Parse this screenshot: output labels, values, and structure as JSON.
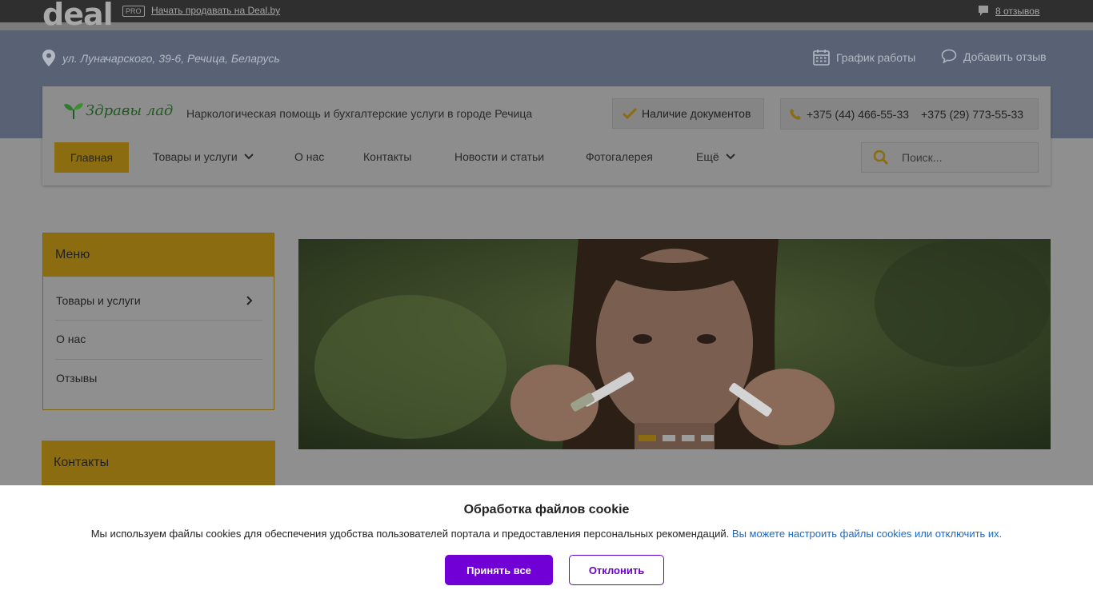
{
  "topbar": {
    "logo": "deal",
    "pro_badge": "PRO",
    "sell_link": "Начать продавать на Deal.by",
    "reviews_link": "8 отзывов"
  },
  "header": {
    "address": "ул. Луначарского, 39-6, Речица, Беларусь",
    "schedule": "График работы",
    "add_review": "Добавить отзыв"
  },
  "company": {
    "brand_name": "Здравы лад",
    "tagline": "Наркологическая помощь и бухгалтерские услуги в городе Речица",
    "documents": "Наличие документов",
    "phone1": "+375 (44) 466-55-33",
    "phone2": "+375 (29) 773-55-33"
  },
  "nav": {
    "items": [
      "Главная",
      "Товары и услуги",
      "О нас",
      "Контакты",
      "Новости и статьи",
      "Фотогалерея",
      "Ещё"
    ],
    "search_placeholder": "Поиск..."
  },
  "sidebar": {
    "menu_title": "Меню",
    "menu_items": [
      "Товары и услуги",
      "О нас",
      "Отзывы"
    ],
    "contacts_title": "Контакты"
  },
  "slider": {
    "slide_count": 4,
    "active_index": 0
  },
  "cookie": {
    "title": "Обработка файлов cookie",
    "text": "Мы используем файлы cookies для обеспечения удобства пользователей портала и предоставления персональных рекомендаций.",
    "link": "Вы можете настроить файлы cookies или отключить их.",
    "accept": "Принять все",
    "decline": "Отклонить"
  },
  "colors": {
    "accent": "#f7be17",
    "accent_dimmed": "#8c6c10",
    "cookie_button": "#7000d6",
    "link": "#1a6ac7"
  }
}
